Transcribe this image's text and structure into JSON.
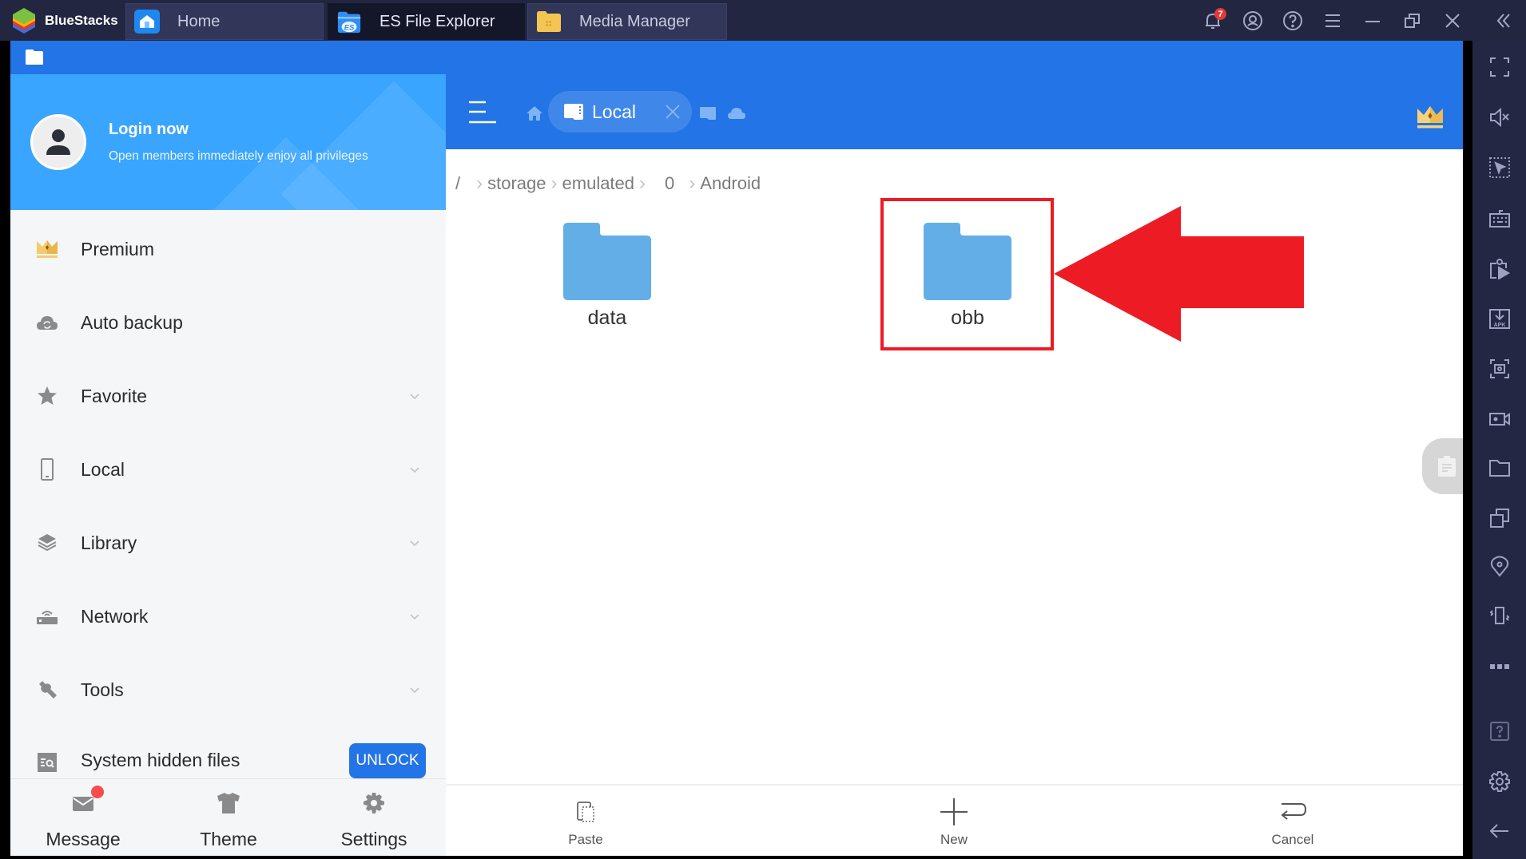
{
  "window": {
    "app_name": "BlueStacks",
    "tabs": [
      {
        "label": "Home",
        "icon": "home-app-icon",
        "active": false
      },
      {
        "label": "ES File Explorer",
        "icon": "es-file-explorer-icon",
        "active": true
      },
      {
        "label": "Media Manager",
        "icon": "media-manager-icon",
        "active": false
      }
    ],
    "notification_count": "7",
    "controls": [
      "notifications",
      "account",
      "help",
      "menu",
      "minimize",
      "restore",
      "close",
      "collapse-sidebar"
    ]
  },
  "right_sidebar": {
    "items": [
      "fullscreen",
      "mute",
      "macro-pointer",
      "keyboard-controls",
      "screen-recorder-media",
      "install-apk",
      "screenshot",
      "video-record",
      "media-folder",
      "multi-instance",
      "location",
      "shake",
      "more",
      "help",
      "settings",
      "back"
    ]
  },
  "drawer": {
    "login_title": "Login now",
    "login_subtitle": "Open members immediately enjoy all privileges",
    "items": [
      {
        "label": "Premium",
        "icon": "crown-icon",
        "expandable": false
      },
      {
        "label": "Auto backup",
        "icon": "cloud-sync-icon",
        "expandable": false
      },
      {
        "label": "Favorite",
        "icon": "star-icon",
        "expandable": true
      },
      {
        "label": "Local",
        "icon": "phone-icon",
        "expandable": true
      },
      {
        "label": "Library",
        "icon": "layers-icon",
        "expandable": true
      },
      {
        "label": "Network",
        "icon": "router-icon",
        "expandable": true
      },
      {
        "label": "Tools",
        "icon": "wrench-icon",
        "expandable": true
      },
      {
        "label": "System hidden files",
        "icon": "hidden-files-icon",
        "expandable": false
      }
    ],
    "unlock_label": "UNLOCK",
    "footer": [
      {
        "label": "Message",
        "icon": "mail-icon",
        "has_dot": true
      },
      {
        "label": "Theme",
        "icon": "shirt-icon",
        "has_dot": false
      },
      {
        "label": "Settings",
        "icon": "gear-icon",
        "has_dot": false
      }
    ]
  },
  "toolbar": {
    "active_location": "Local"
  },
  "breadcrumb": [
    "/",
    "storage",
    "emulated",
    "0",
    "Android"
  ],
  "files": [
    {
      "name": "data",
      "type": "folder"
    },
    {
      "name": "obb",
      "type": "folder",
      "highlighted": true
    }
  ],
  "bottom_actions": [
    {
      "label": "Paste",
      "icon": "paste-icon"
    },
    {
      "label": "New",
      "icon": "plus-icon"
    },
    {
      "label": "Cancel",
      "icon": "return-icon"
    }
  ],
  "colors": {
    "app_blue": "#2374e6",
    "drawer_header": "#3aa5ff",
    "folder": "#64aee8",
    "annotation_red": "#ed1c24",
    "titlebar": "#222640"
  }
}
